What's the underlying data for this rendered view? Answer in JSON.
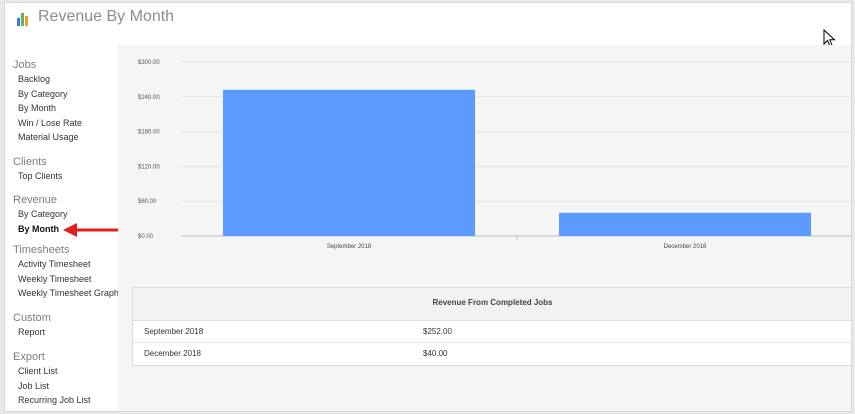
{
  "window": {
    "title": "Revenue By Month"
  },
  "sidebar": {
    "groups": [
      {
        "heading": "Jobs",
        "items": [
          "Backlog",
          "By Category",
          "By Month",
          "Win / Lose Rate",
          "Material Usage"
        ]
      },
      {
        "heading": "Clients",
        "items": [
          "Top Clients"
        ]
      },
      {
        "heading": "Revenue",
        "items": [
          "By Category",
          "By Month"
        ]
      },
      {
        "heading": "Timesheets",
        "items": [
          "Activity Timesheet",
          "Weekly Timesheet",
          "Weekly Timesheet Graph"
        ]
      },
      {
        "heading": "Custom",
        "items": [
          "Report"
        ]
      },
      {
        "heading": "Export",
        "items": [
          "Client List",
          "Job List",
          "Recurring Job List"
        ]
      }
    ],
    "active": "Revenue / By Month"
  },
  "colors": {
    "bar": "#5b9bff",
    "arrow": "#e02020",
    "icon_green": "#5cb85c",
    "icon_blue": "#3a7bd5",
    "icon_orange": "#f0a030"
  },
  "chart_data": {
    "type": "bar",
    "categories": [
      "September 2018",
      "December 2018"
    ],
    "values": [
      252,
      40
    ],
    "ylim": [
      0,
      300
    ],
    "yticks": [
      "$0.00",
      "$60.00",
      "$120.00",
      "$180.00",
      "$240.00",
      "$300.00"
    ],
    "ytick_values": [
      0,
      60,
      120,
      180,
      240,
      300
    ],
    "grid": true,
    "title": "",
    "xlabel": "",
    "ylabel": ""
  },
  "table": {
    "header": "Revenue From Completed Jobs",
    "rows": [
      {
        "month": "September 2018",
        "amount": "$252.00"
      },
      {
        "month": "December 2018",
        "amount": "$40.00"
      }
    ]
  }
}
